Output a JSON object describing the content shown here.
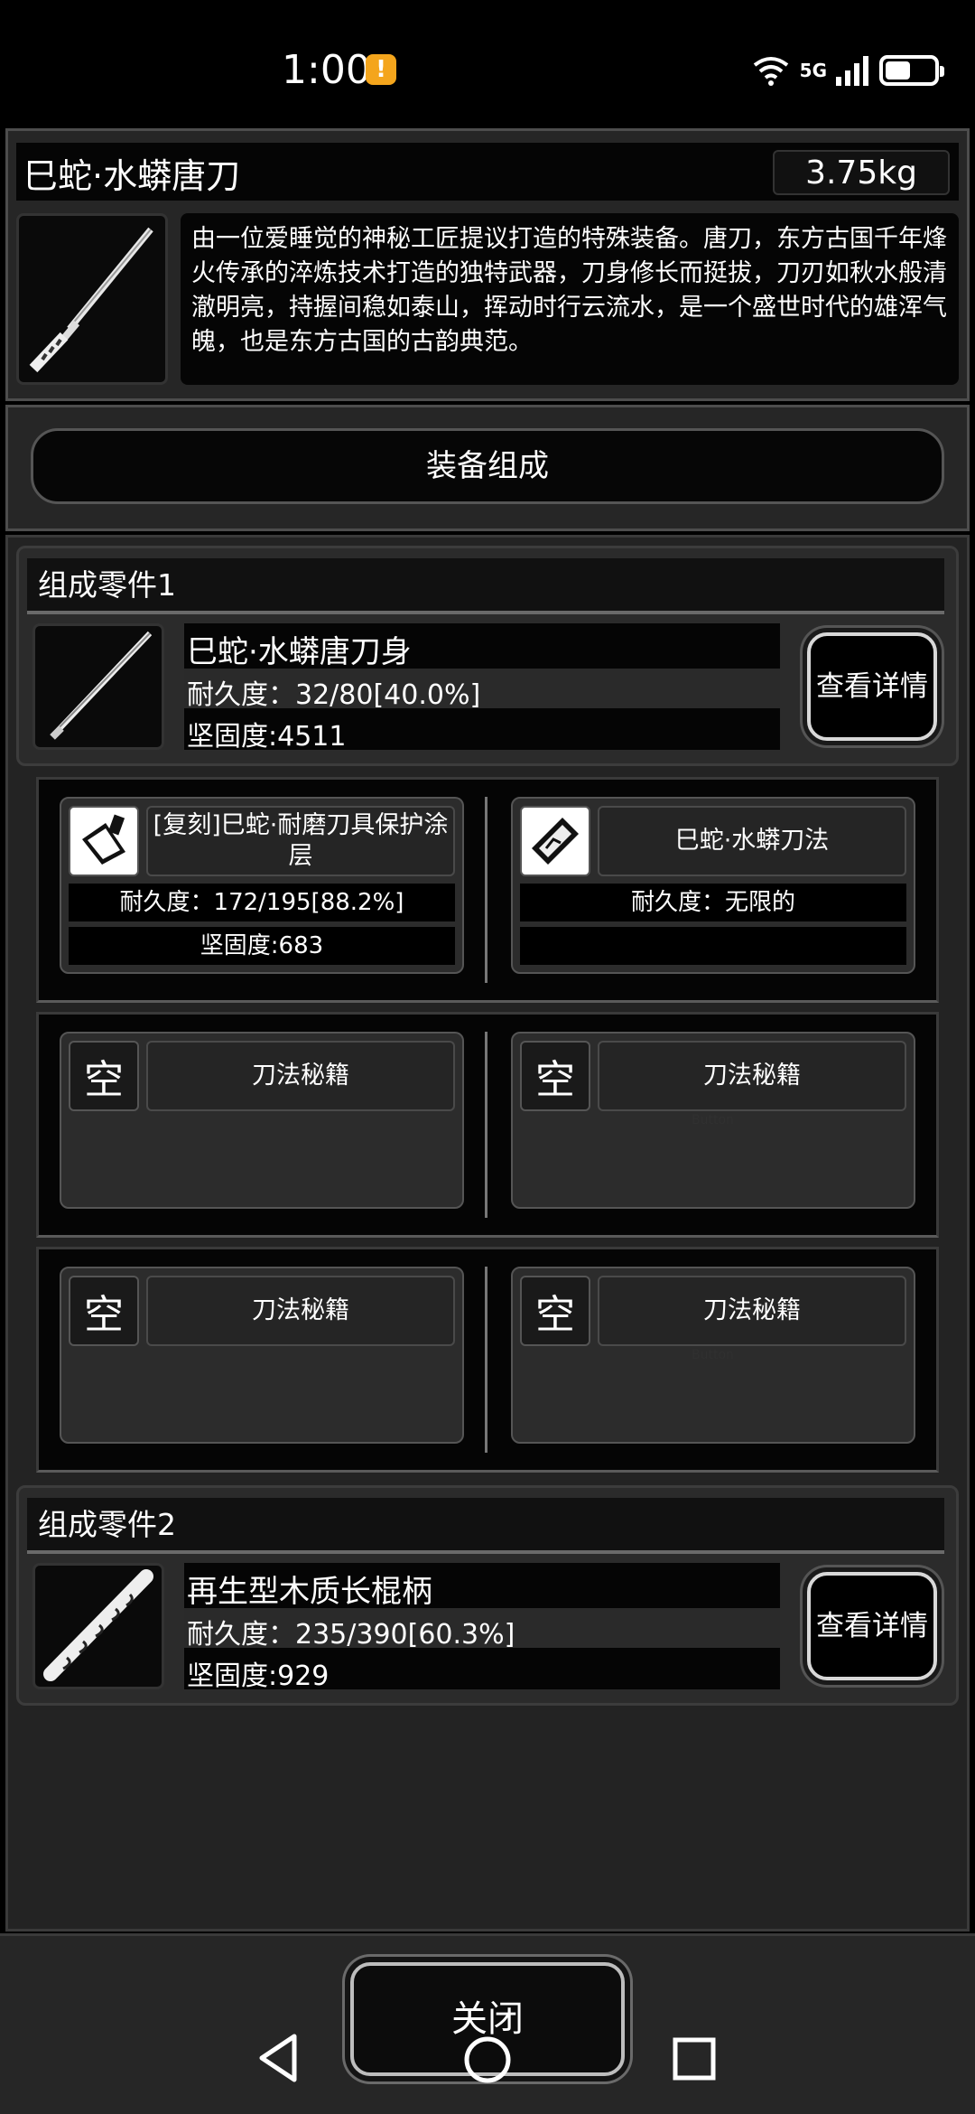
{
  "status_bar": {
    "time": "1:00",
    "alert_icon": "!",
    "network_label": "5G",
    "wifi_label": "6"
  },
  "item": {
    "name": "巳蛇·水蟒唐刀",
    "weight": "3.75kg",
    "icon": "katana-icon",
    "description": "由一位爱睡觉的神秘工匠提议打造的特殊装备。唐刀，东方古国千年烽火传承的淬炼技术打造的独特武器，刀身修长而挺拔，刀刃如秋水般清澈明亮，持握间稳如泰山，挥动时行云流水，是一个盛世时代的雄浑气魄，也是东方古国的古韵典范。"
  },
  "composition_button": "装备组成",
  "parts": [
    {
      "header": "组成零件1",
      "name": "巳蛇·水蟒唐刀身",
      "durability": "耐久度：32/80[40.0%]",
      "hardness": "坚固度:4511",
      "detail_button": "查看详情",
      "icon": "blade-icon"
    },
    {
      "header": "组成零件2",
      "name": "再生型木质长棍柄",
      "durability": "耐久度：235/390[60.3%]",
      "hardness": "坚固度:929",
      "detail_button": "查看详情",
      "icon": "staff-handle-icon"
    }
  ],
  "slots": [
    {
      "name": "[复刻]巳蛇·耐磨刀具保护涂层",
      "stat1": "耐久度：172/195[88.2%]",
      "stat2": "坚固度:683",
      "icon": "whetstone-icon"
    },
    {
      "name": "巳蛇·水蟒刀法",
      "stat1": "耐久度：无限的",
      "stat2": "",
      "icon": "scroll-icon"
    },
    {
      "name": "刀法秘籍",
      "empty_label": "空"
    },
    {
      "name": "刀法秘籍",
      "empty_label": "空",
      "ghost": "Button"
    },
    {
      "name": "刀法秘籍",
      "empty_label": "空"
    },
    {
      "name": "刀法秘籍",
      "empty_label": "空",
      "ghost": "Button"
    }
  ],
  "close_button": "关闭",
  "colors": {
    "background": "#000000",
    "panel": "#262626",
    "alert": "#f4a51c"
  }
}
